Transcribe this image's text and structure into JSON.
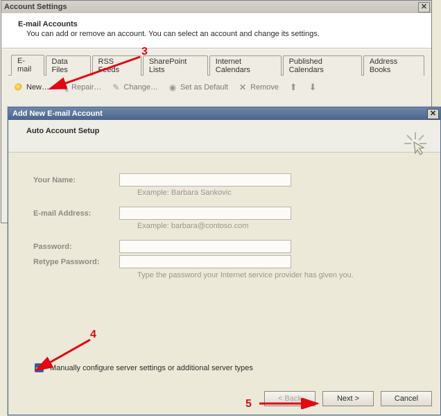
{
  "account_settings": {
    "window_title": "Account Settings",
    "header_title": "E-mail Accounts",
    "header_sub": "You can add or remove an account. You can select an account and change its settings.",
    "tabs": [
      {
        "label": "E-mail"
      },
      {
        "label": "Data Files"
      },
      {
        "label": "RSS Feeds"
      },
      {
        "label": "SharePoint Lists"
      },
      {
        "label": "Internet Calendars"
      },
      {
        "label": "Published Calendars"
      },
      {
        "label": "Address Books"
      }
    ],
    "toolbar": {
      "new_label": "New…",
      "repair_label": "Repair…",
      "change_label": "Change…",
      "default_label": "Set as Default",
      "remove_label": "Remove"
    }
  },
  "add_account": {
    "window_title": "Add New E-mail Account",
    "header_title": "Auto Account Setup",
    "form": {
      "your_name_label": "Your Name:",
      "your_name_value": "",
      "your_name_hint": "Example: Barbara Sankovic",
      "email_label": "E-mail Address:",
      "email_value": "",
      "email_hint": "Example: barbara@contoso.com",
      "password_label": "Password:",
      "password_value": "",
      "retype_label": "Retype Password:",
      "retype_value": "",
      "password_hint": "Type the password your Internet service provider has given you."
    },
    "manual_checkbox_label": "Manually configure server settings or additional server types",
    "manual_checked": true,
    "buttons": {
      "back_label": "< Back",
      "next_label": "Next >",
      "cancel_label": "Cancel"
    }
  },
  "annotations": {
    "step3": "3",
    "step4": "4",
    "step5": "5"
  },
  "colors": {
    "accent_red": "#e30613",
    "titlebar_blue": "#5a7299",
    "panel_bg": "#ece9d8"
  }
}
